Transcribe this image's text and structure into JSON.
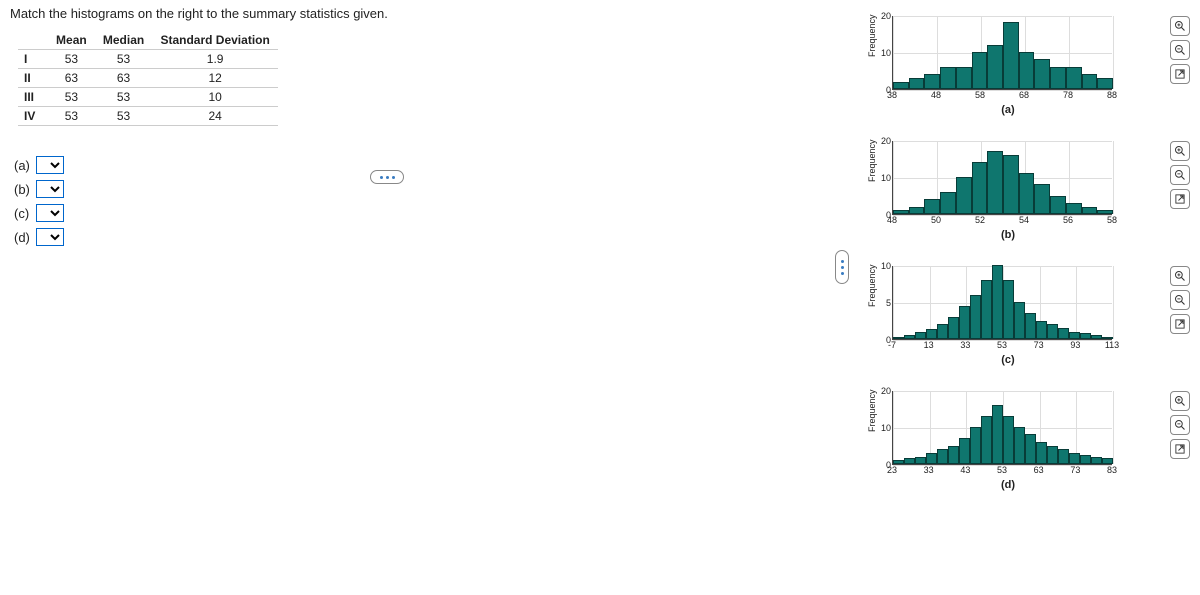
{
  "prompt": "Match the histograms on the right to the summary statistics given.",
  "table": {
    "headers": [
      "",
      "Mean",
      "Median",
      "Standard Deviation"
    ],
    "rows": [
      {
        "id": "I",
        "mean": "53",
        "median": "53",
        "sd": "1.9"
      },
      {
        "id": "II",
        "mean": "63",
        "median": "63",
        "sd": "12"
      },
      {
        "id": "III",
        "mean": "53",
        "median": "53",
        "sd": "10"
      },
      {
        "id": "IV",
        "mean": "53",
        "median": "53",
        "sd": "24"
      }
    ]
  },
  "selects": [
    {
      "label": "(a)"
    },
    {
      "label": "(b)"
    },
    {
      "label": "(c)"
    },
    {
      "label": "(d)"
    }
  ],
  "ylabel": "Frequency",
  "charts": [
    {
      "caption": "(a)",
      "yticks": [
        "0",
        "10",
        "20"
      ],
      "ymax": 20,
      "xticks": [
        "38",
        "48",
        "58",
        "68",
        "78",
        "88"
      ],
      "bars": [
        2,
        3,
        4,
        6,
        6,
        10,
        12,
        18,
        10,
        8,
        6,
        6,
        4,
        3
      ]
    },
    {
      "caption": "(b)",
      "yticks": [
        "0",
        "10",
        "20"
      ],
      "ymax": 20,
      "xticks": [
        "48",
        "50",
        "52",
        "54",
        "56",
        "58"
      ],
      "bars": [
        1,
        2,
        4,
        6,
        10,
        14,
        17,
        16,
        11,
        8,
        5,
        3,
        2,
        1
      ]
    },
    {
      "caption": "(c)",
      "yticks": [
        "0",
        "5",
        "10"
      ],
      "ymax": 10,
      "xticks": [
        "-7",
        "13",
        "33",
        "53",
        "73",
        "93",
        "113"
      ],
      "bars": [
        0.3,
        0.6,
        1,
        1.4,
        2,
        3,
        4.5,
        6,
        8,
        10,
        8,
        5,
        3.5,
        2.5,
        2,
        1.5,
        1,
        0.8,
        0.5,
        0.3
      ]
    },
    {
      "caption": "(d)",
      "yticks": [
        "0",
        "10",
        "20"
      ],
      "ymax": 20,
      "xticks": [
        "23",
        "33",
        "43",
        "53",
        "63",
        "73",
        "83"
      ],
      "bars": [
        1,
        1.5,
        2,
        3,
        4,
        5,
        7,
        10,
        13,
        16,
        13,
        10,
        8,
        6,
        5,
        4,
        3,
        2.5,
        2,
        1.5
      ]
    }
  ],
  "icons": {
    "zoom_in": "zoom-in-icon",
    "zoom_out": "zoom-out-icon",
    "popout": "popout-icon"
  }
}
